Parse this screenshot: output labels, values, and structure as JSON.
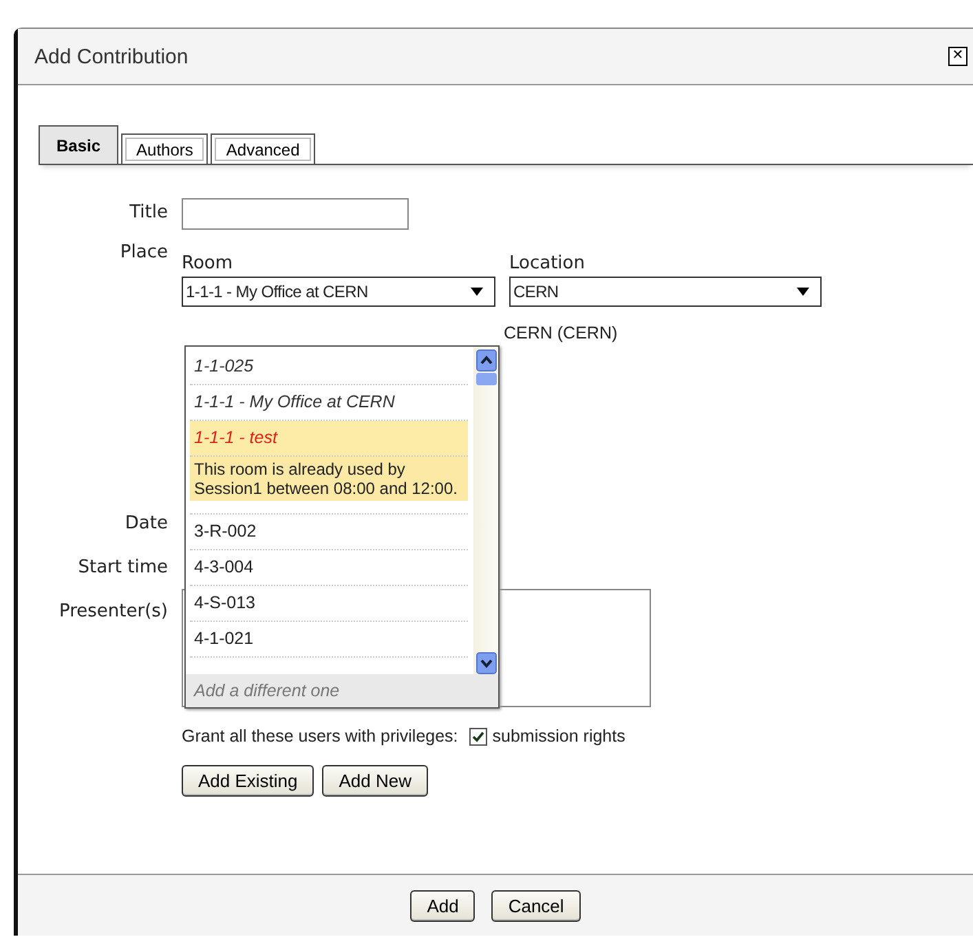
{
  "window": {
    "title": "Add Contribution",
    "close": "✕"
  },
  "tabs": [
    {
      "label": "Basic",
      "selected": true
    },
    {
      "label": "Authors",
      "selected": false
    },
    {
      "label": "Advanced",
      "selected": false
    }
  ],
  "form": {
    "title_label": "Title",
    "place_label": "Place",
    "room_label": "Room",
    "room_value": "1-1-1 - My Office at CERN",
    "location_label": "Location",
    "location_value": "CERN",
    "location_note": "CERN (CERN)",
    "date_label": "Date",
    "start_time_label": "Start time",
    "presenters_label": "Presenter(s)",
    "grant_text": "Grant all these users with privileges:",
    "submission_rights": {
      "label": "submission rights",
      "checked": true
    }
  },
  "room_dropdown": {
    "items": [
      {
        "label": "1-1-025",
        "italic": true,
        "selected": false
      },
      {
        "label": "1-1-1 - My Office at CERN",
        "italic": true,
        "selected": false
      },
      {
        "label": "1-1-1 - test",
        "italic": true,
        "selected": true
      },
      {
        "label": "3-R-002",
        "italic": false,
        "selected": false
      },
      {
        "label": "4-3-004",
        "italic": false,
        "selected": false
      },
      {
        "label": "4-S-013",
        "italic": false,
        "selected": false
      },
      {
        "label": "4-1-021",
        "italic": false,
        "selected": false
      }
    ],
    "tooltip": "This room is already used by Session1 between 08:00 and 12:00.",
    "footer": "Add a different one"
  },
  "presenter_buttons": [
    "Add Existing",
    "Add New"
  ],
  "footer_buttons": [
    "Add",
    "Cancel"
  ]
}
